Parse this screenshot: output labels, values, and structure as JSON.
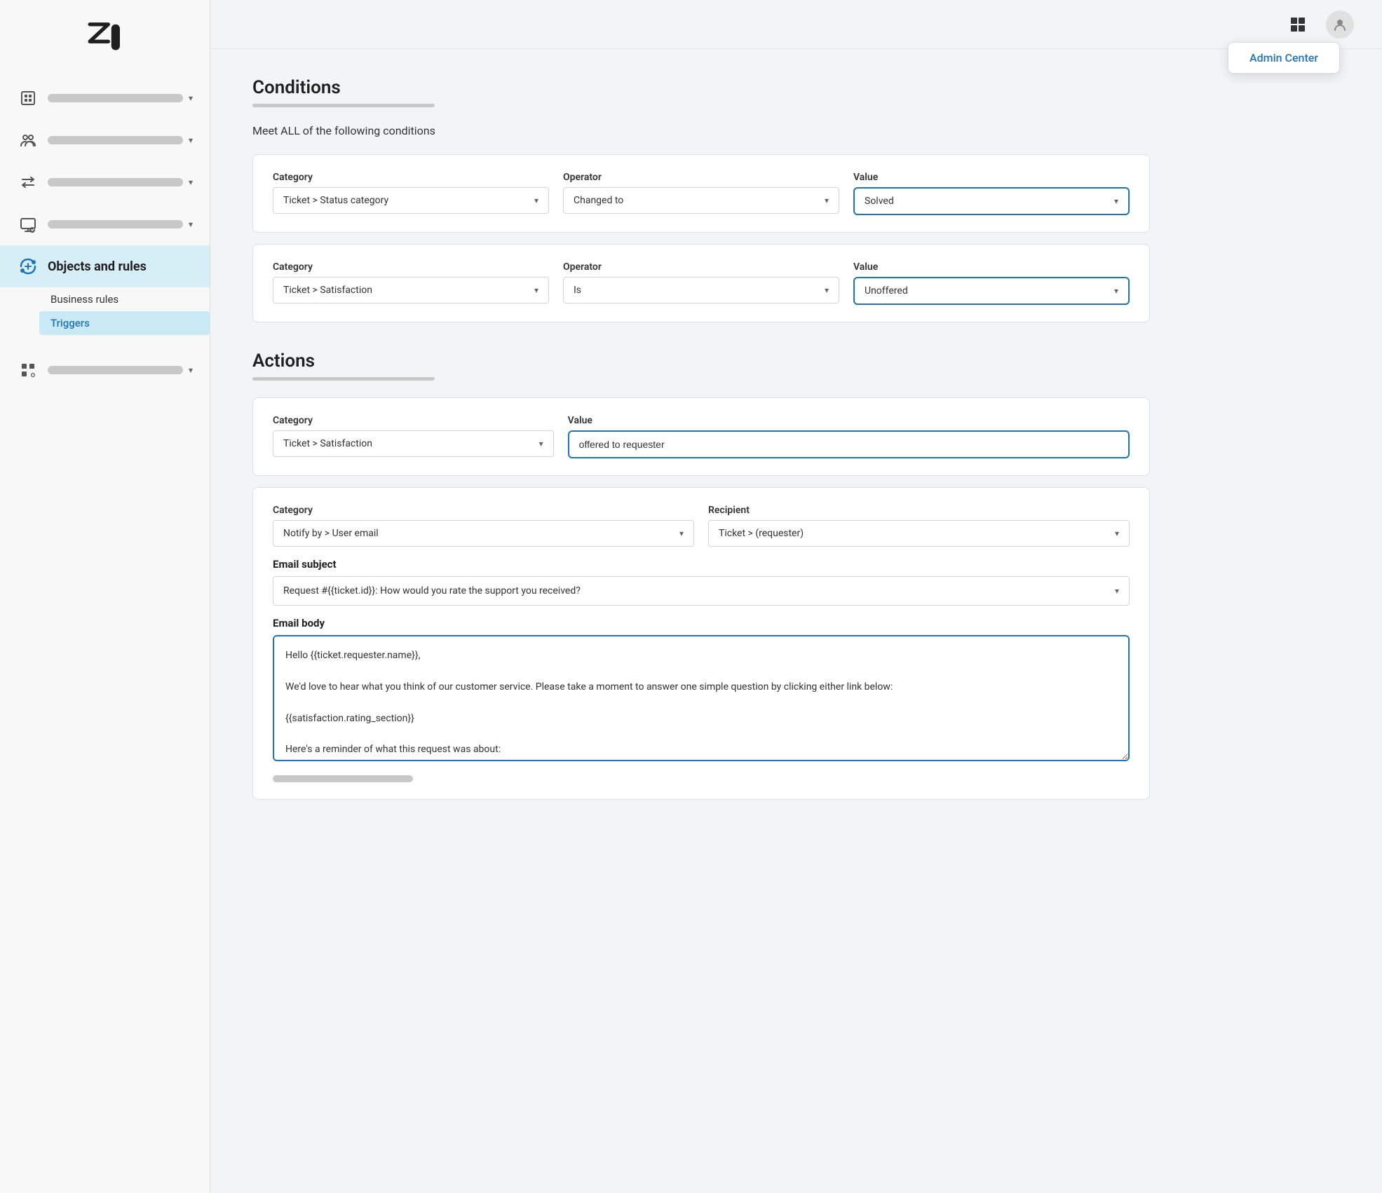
{
  "sidebar": {
    "logo_alt": "Zendesk",
    "nav_items": [
      {
        "id": "building",
        "icon": "building-icon",
        "active": false
      },
      {
        "id": "people",
        "icon": "people-icon",
        "active": false
      },
      {
        "id": "arrows",
        "icon": "arrows-icon",
        "active": false
      },
      {
        "id": "monitor",
        "icon": "monitor-icon",
        "active": false
      },
      {
        "id": "objects",
        "icon": "objects-icon",
        "active": true,
        "label": "Objects and rules"
      },
      {
        "id": "apps",
        "icon": "apps-icon",
        "active": false
      }
    ],
    "sub_nav": {
      "business_rules": "Business rules",
      "triggers": "Triggers"
    }
  },
  "topbar": {
    "admin_center_label": "Admin Center"
  },
  "conditions": {
    "title": "Conditions",
    "subtitle": "Meet ALL of the following conditions",
    "row1": {
      "category_label": "Category",
      "category_value": "Ticket > Status category",
      "operator_label": "Operator",
      "operator_value": "Changed to",
      "value_label": "Value",
      "value_value": "Solved"
    },
    "row2": {
      "category_label": "Category",
      "category_value": "Ticket > Satisfaction",
      "operator_label": "Operator",
      "operator_value": "Is",
      "value_label": "Value",
      "value_value": "Unoffered"
    }
  },
  "actions": {
    "title": "Actions",
    "row1": {
      "category_label": "Category",
      "category_value": "Ticket > Satisfaction",
      "value_label": "Value",
      "value_value": "offered to requester"
    },
    "row2": {
      "category_label": "Category",
      "category_value": "Notify by > User email",
      "recipient_label": "Recipient",
      "recipient_value": "Ticket > (requester)"
    },
    "email_subject_label": "Email subject",
    "email_subject_value": "Request #{{ticket.id}}: How would you rate the support you received?",
    "email_body_label": "Email body",
    "email_body_value": "Hello {{ticket.requester.name}},\n\nWe'd love to hear what you think of our customer service. Please take a moment to answer one simple question by clicking either link below:\n\n{{satisfaction.rating_section}}\n\nHere's a reminder of what this request was about:"
  }
}
